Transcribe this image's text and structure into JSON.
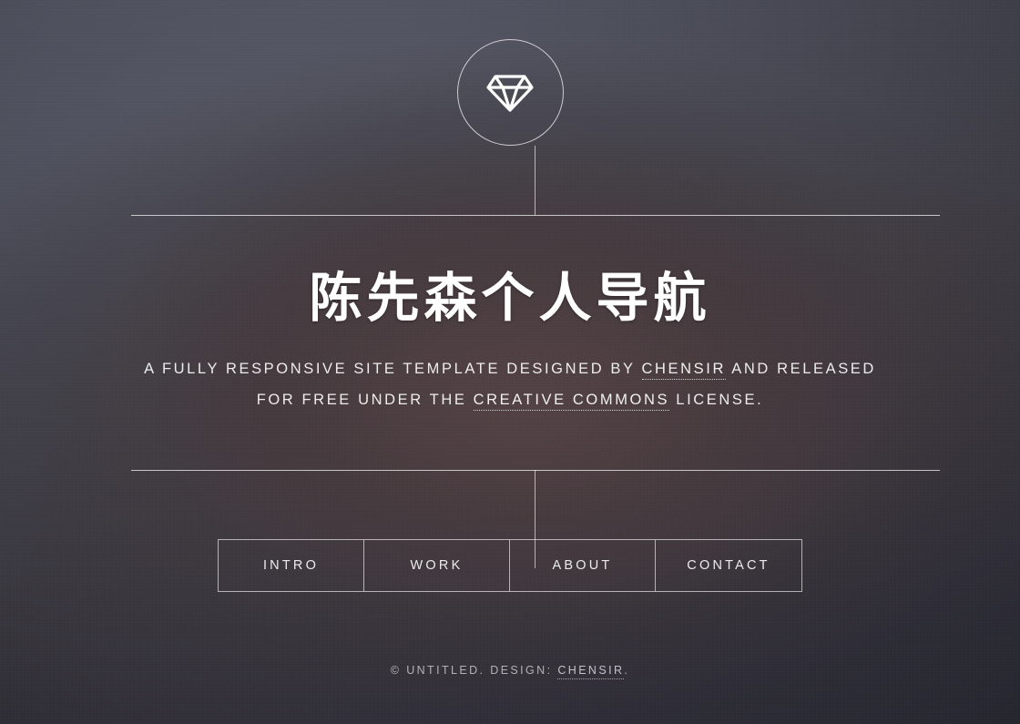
{
  "colors": {
    "bg_top_left": "#5a5e6b",
    "bg_top_right": "#595c69",
    "bg_center": "#3e3537",
    "bg_bottom_left": "#2e3038",
    "line": "#ffffff",
    "text": "#ffffff"
  },
  "logo": {
    "icon": "diamond-icon"
  },
  "hero": {
    "headline": "陈先森个人导航",
    "subtitle": {
      "line1_before": "A FULLY RESPONSIVE SITE TEMPLATE DESIGNED BY ",
      "line1_link": "CHENSIR",
      "line1_after": " AND RELEASED",
      "line2_before": "FOR FREE UNDER THE ",
      "line2_link": "CREATIVE COMMONS",
      "line2_after": " LICENSE."
    }
  },
  "nav": {
    "items": [
      {
        "label": "INTRO"
      },
      {
        "label": "WORK"
      },
      {
        "label": "ABOUT"
      },
      {
        "label": "CONTACT"
      }
    ]
  },
  "footer": {
    "before": "© UNTITLED. DESIGN: ",
    "link": "CHENSIR",
    "after": "."
  }
}
